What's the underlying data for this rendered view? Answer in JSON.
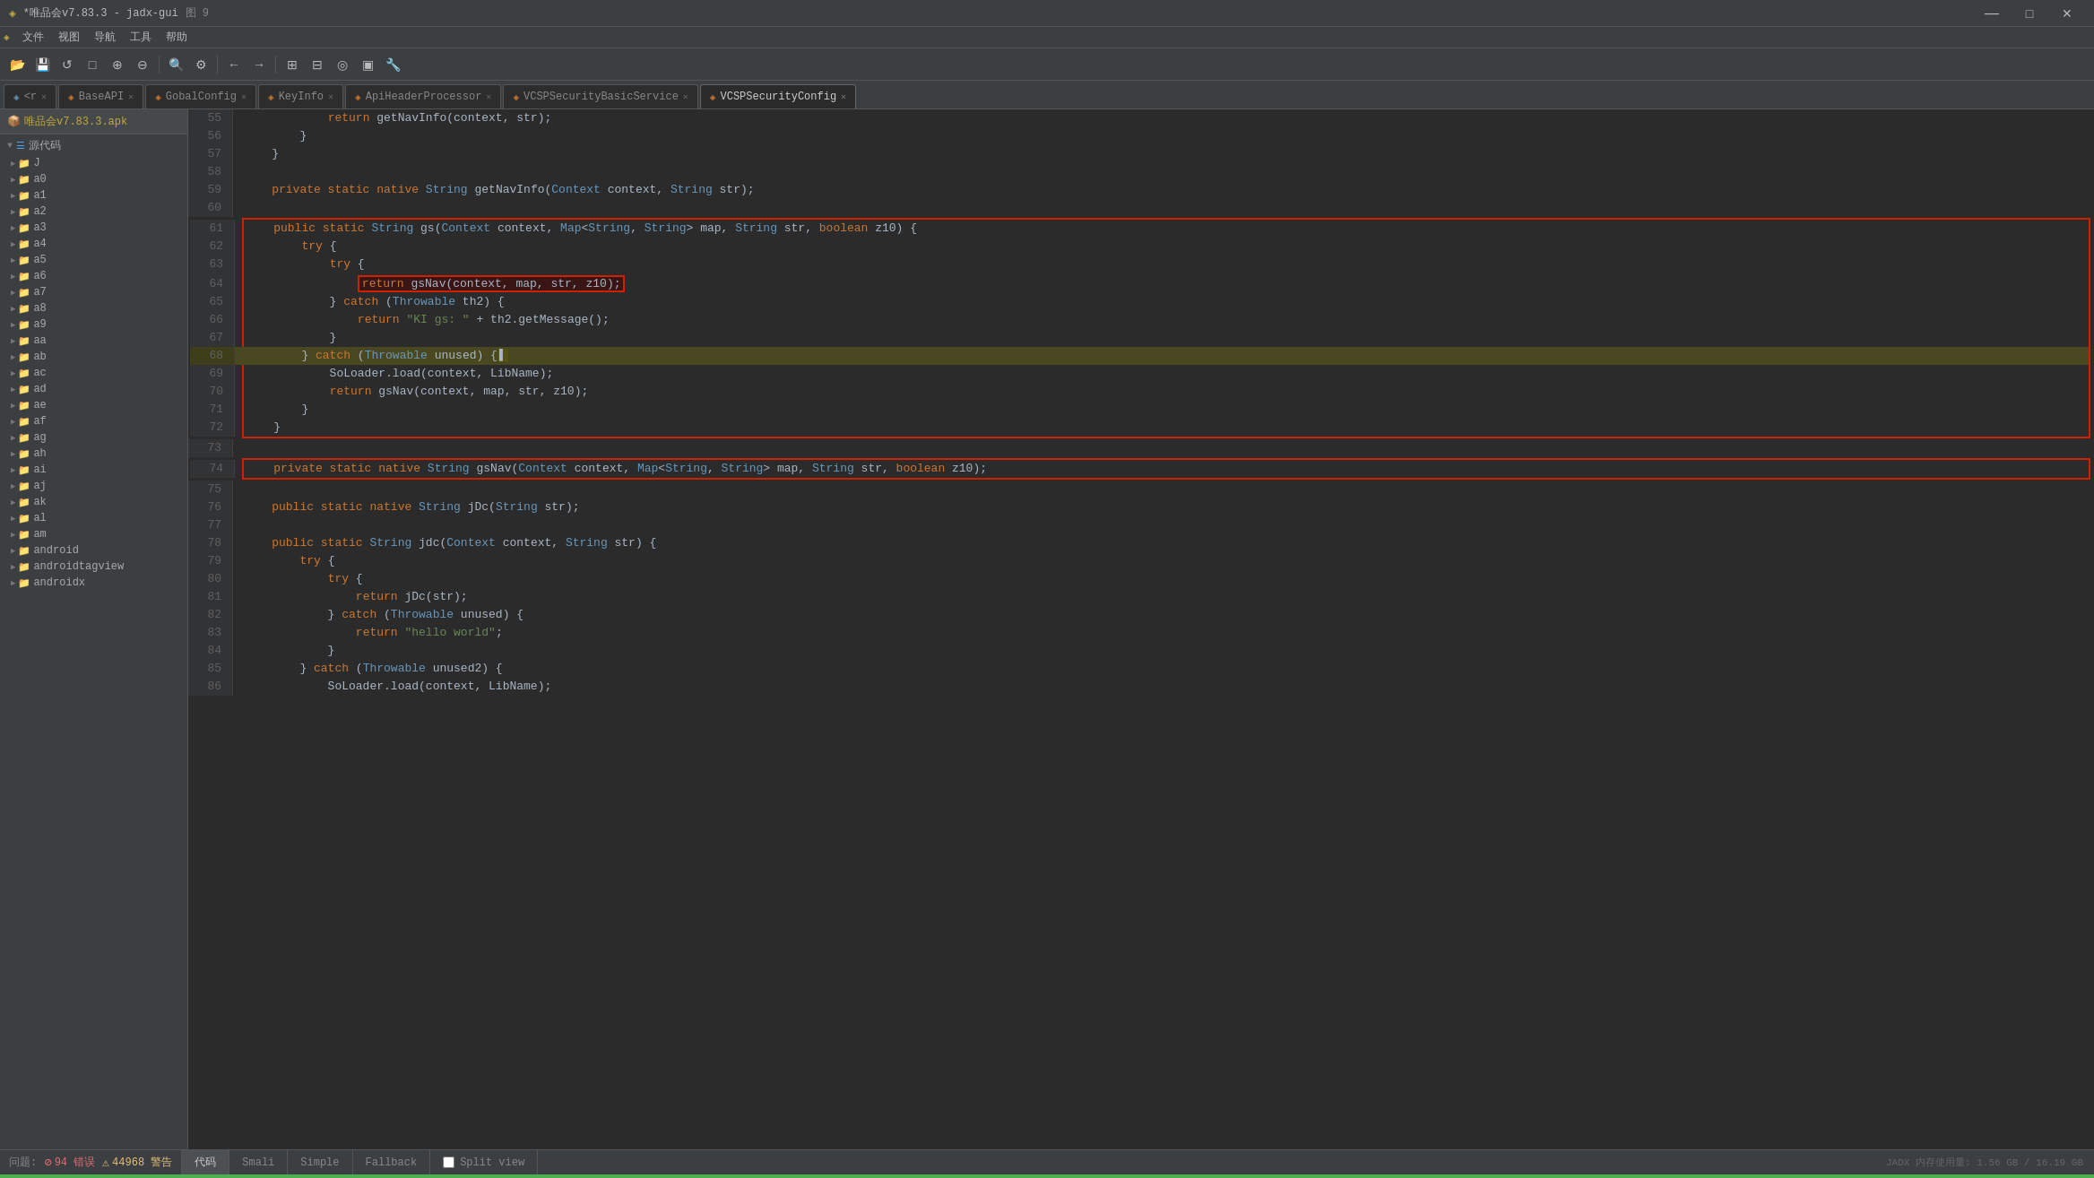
{
  "titleBar": {
    "title": "*唯品会v7.83.3 - jadx-gui",
    "subtitle": "图 9",
    "controls": [
      "—",
      "□",
      "✕"
    ]
  },
  "menuBar": {
    "items": [
      "文件",
      "视图",
      "导航",
      "工具",
      "帮助"
    ]
  },
  "toolbar": {
    "buttons": [
      "☰",
      "◁",
      "▷",
      "↺",
      "□",
      "⊕",
      "⊖",
      "Q",
      "⊙",
      "←",
      "→",
      "⊞",
      "⊟",
      "⊛",
      "▣",
      "🔧"
    ]
  },
  "tabs": [
    {
      "label": "<r",
      "active": false,
      "color": "#6897bb"
    },
    {
      "label": "BaseAPI",
      "active": false,
      "color": "#cc7832"
    },
    {
      "label": "GobalConfig",
      "active": false,
      "color": "#cc7832"
    },
    {
      "label": "KeyInfo",
      "active": false,
      "color": "#cc7832"
    },
    {
      "label": "ApiHeaderProcessor",
      "active": false,
      "color": "#cc7832"
    },
    {
      "label": "VCSPSecurityBasicService",
      "active": false,
      "color": "#cc7832"
    },
    {
      "label": "VCSPSecurityConfig",
      "active": true,
      "color": "#cc7832"
    }
  ],
  "sidebar": {
    "appTitle": "唯品会v7.83.3.apk",
    "sourcesLabel": "源代码",
    "items": [
      "J",
      "a0",
      "a1",
      "a2",
      "a3",
      "a4",
      "a5",
      "a6",
      "a7",
      "a8",
      "a9",
      "aa",
      "ab",
      "ac",
      "ad",
      "ae",
      "af",
      "ag",
      "ah",
      "ai",
      "aj",
      "ak",
      "al",
      "am",
      "android",
      "androidtagview",
      "androidx"
    ]
  },
  "code": {
    "lines": [
      {
        "num": 55,
        "content": "            return getNavInfo(context, str);",
        "highlight": false
      },
      {
        "num": 56,
        "content": "        }",
        "highlight": false
      },
      {
        "num": 57,
        "content": "    }",
        "highlight": false
      },
      {
        "num": 58,
        "content": "",
        "highlight": false
      },
      {
        "num": 59,
        "content": "    private static native String getNavInfo(Context context, String str);",
        "highlight": false
      },
      {
        "num": 60,
        "content": "",
        "highlight": false
      },
      {
        "num": 61,
        "content": "    public static String gs(Context context, Map<String, String> map, String str, boolean z10) {",
        "highlight": false,
        "redBoxStart": true
      },
      {
        "num": 62,
        "content": "        try {",
        "highlight": false
      },
      {
        "num": 63,
        "content": "            try {",
        "highlight": false
      },
      {
        "num": 64,
        "content": "                return gsNav(context, map, str, z10);",
        "highlight": false,
        "inlineRedBox": true
      },
      {
        "num": 65,
        "content": "            } catch (Throwable th2) {",
        "highlight": false
      },
      {
        "num": 66,
        "content": "                return \"KI gs: \" + th2.getMessage();",
        "highlight": false
      },
      {
        "num": 67,
        "content": "            }",
        "highlight": false
      },
      {
        "num": 68,
        "content": "        } catch (Throwable unused) {",
        "highlight": true,
        "yellowHighlight": true
      },
      {
        "num": 69,
        "content": "            SoLoader.load(context, LibName);",
        "highlight": false
      },
      {
        "num": 70,
        "content": "            return gsNav(context, map, str, z10);",
        "highlight": false
      },
      {
        "num": 71,
        "content": "        }",
        "highlight": false
      },
      {
        "num": 72,
        "content": "    }",
        "highlight": false,
        "redBoxEnd": true
      },
      {
        "num": 73,
        "content": "",
        "highlight": false
      },
      {
        "num": 74,
        "content": "    private static native String gsNav(Context context, Map<String, String> map, String str, boolean z10);",
        "highlight": false,
        "redBox2": true
      },
      {
        "num": 75,
        "content": "",
        "highlight": false
      },
      {
        "num": 76,
        "content": "    public static native String jDc(String str);",
        "highlight": false
      },
      {
        "num": 77,
        "content": "",
        "highlight": false
      },
      {
        "num": 78,
        "content": "    public static String jdc(Context context, String str) {",
        "highlight": false
      },
      {
        "num": 79,
        "content": "        try {",
        "highlight": false
      },
      {
        "num": 80,
        "content": "            try {",
        "highlight": false
      },
      {
        "num": 81,
        "content": "                return jDc(str);",
        "highlight": false
      },
      {
        "num": 82,
        "content": "            } catch (Throwable unused) {",
        "highlight": false
      },
      {
        "num": 83,
        "content": "                return \"hello world\";",
        "highlight": false
      },
      {
        "num": 84,
        "content": "            }",
        "highlight": false
      },
      {
        "num": 85,
        "content": "        } catch (Throwable unused2) {",
        "highlight": false
      },
      {
        "num": 86,
        "content": "            SoLoader.load(context, LibName);",
        "highlight": false
      }
    ]
  },
  "statusBar": {
    "problemsLabel": "问题:",
    "errorsCount": "94 错误",
    "warningsCount": "44968 警告",
    "tabs": [
      "代码",
      "Smali",
      "Simple",
      "Fallback"
    ],
    "activeTab": "代码",
    "splitViewLabel": "Split view",
    "memoryInfo": "JADX 内存使用量: 1.56 GB / 16.19 GB"
  },
  "colors": {
    "keyword": "#cc7832",
    "type": "#6897bb",
    "string": "#6a8759",
    "background": "#2b2b2b",
    "lineHighlight": "#4a4820",
    "redBorder": "#cc2200",
    "sidebar": "#3c3f41"
  }
}
